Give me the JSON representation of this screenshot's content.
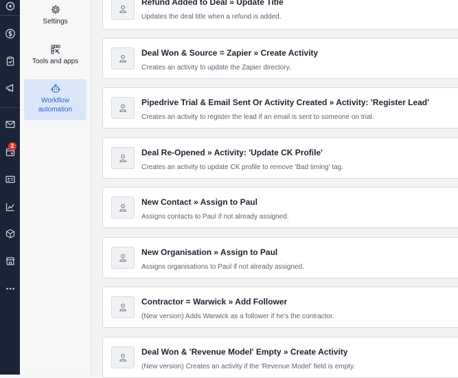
{
  "rail": {
    "icons": [
      "target-icon",
      "dollar-icon",
      "clipboard-check-icon",
      "megaphone-icon",
      "mail-icon",
      "calendar-icon",
      "contact-card-icon",
      "chart-icon",
      "box-icon",
      "store-icon",
      "more-icon"
    ],
    "badge": "2"
  },
  "settings_nav": {
    "items": [
      {
        "label": "Settings",
        "icon": "gear-icon",
        "active": false
      },
      {
        "label": "Tools and apps",
        "icon": "tools-icon",
        "active": false
      },
      {
        "label": "Workflow automation",
        "icon": "robot-icon",
        "active": true
      }
    ]
  },
  "automations": [
    {
      "title": "Refund Added to Deal » Update Title",
      "description": "Updates the deal title when a refund is added."
    },
    {
      "title": "Deal Won & Source = Zapier » Create Activity",
      "description": "Creates an activity to update the Zapier directory."
    },
    {
      "title": "Pipedrive Trial & Email Sent Or Activity Created » Activity: 'Register Lead'",
      "description": "Creates an activity to register the lead if an email is sent to someone on trial."
    },
    {
      "title": "Deal Re-Opened » Activity: 'Update CK Profile'",
      "description": "Creates an activity to update CK profile to remove 'Bad timing' tag."
    },
    {
      "title": "New Contact » Assign to Paul",
      "description": "Assigns contacts to Paul if not already assigned."
    },
    {
      "title": "New Organisation » Assign to Paul",
      "description": "Assigns organisations to Paul if not already assigned."
    },
    {
      "title": "Contractor = Warwick » Add Follower",
      "description": "(New version) Adds Warwick as a follower if he's the contractor."
    },
    {
      "title": "Deal Won & 'Revenue Model' Empty » Create Activity",
      "description": "(New version) Creates an activity if the 'Revenue Model' field is empty."
    }
  ],
  "colors": {
    "rail": "#1b2437",
    "accent": "#2866c9",
    "active_bg": "#dbe7f9"
  }
}
